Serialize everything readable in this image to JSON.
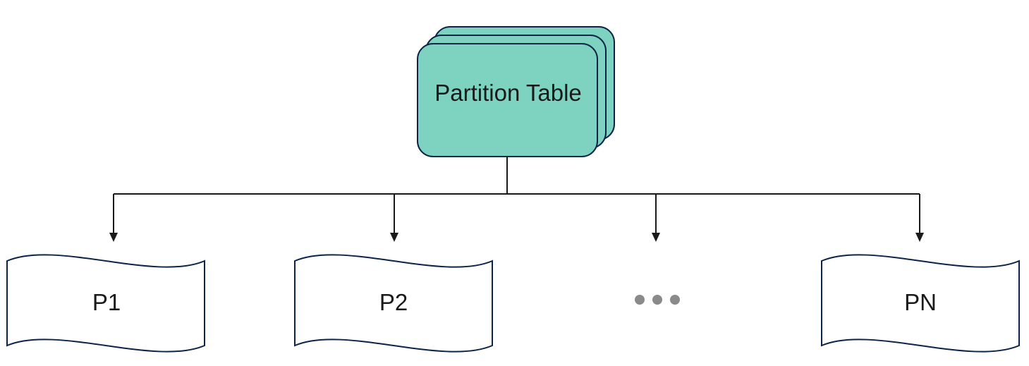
{
  "table": {
    "label": "Partition Table"
  },
  "partitions": {
    "p1": {
      "label": "P1"
    },
    "p2": {
      "label": "P2"
    },
    "pn": {
      "label": "PN"
    }
  },
  "colors": {
    "tableFill": "#7dd3c0",
    "border": "#0b2447",
    "white": "#ffffff",
    "dots": "#8a8a8a"
  }
}
